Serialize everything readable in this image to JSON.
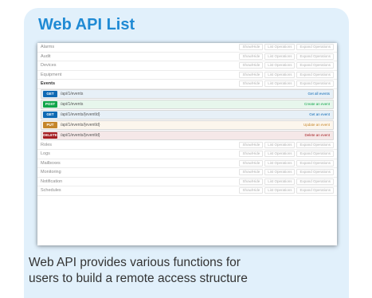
{
  "card": {
    "title": "Web API List",
    "caption_line1": "Web API provides various functions for",
    "caption_line2": "users to build a remote access structure",
    "background_color": "#e1f0fb",
    "title_color": "#1f8ad4"
  },
  "screenshot": {
    "groups_before": [
      {
        "name": "Alarms"
      },
      {
        "name": "Audit"
      },
      {
        "name": "Devices"
      },
      {
        "name": "Equipment"
      }
    ],
    "active_group": {
      "name": "Events"
    },
    "row_actions": [
      "Show/Hide",
      "List Operations",
      "Expand Operations"
    ],
    "endpoints": [
      {
        "method": "GET",
        "path": "/api/1/events",
        "desc": "Get all events",
        "badge_color": "#0f6ab4",
        "row_color": "#e7f0f7",
        "desc_color": "#0f6ab4"
      },
      {
        "method": "POST",
        "path": "/api/1/events",
        "desc": "Create an event",
        "badge_color": "#10a54a",
        "row_color": "#e7f6ec",
        "desc_color": "#10a54a"
      },
      {
        "method": "GET",
        "path": "/api/1/events/{eventId}",
        "desc": "Get an event",
        "badge_color": "#0f6ab4",
        "row_color": "#e7f0f7",
        "desc_color": "#0f6ab4"
      },
      {
        "method": "PUT",
        "path": "/api/1/events/{eventId}",
        "desc": "Update an event",
        "badge_color": "#c5862b",
        "row_color": "#fcf6ed",
        "desc_color": "#c5862b"
      },
      {
        "method": "DELETE",
        "path": "/api/1/events/{eventId}",
        "desc": "Delete an event",
        "badge_color": "#a41e22",
        "row_color": "#f5e8e8",
        "desc_color": "#a41e22"
      }
    ],
    "groups_after": [
      {
        "name": "Roles"
      },
      {
        "name": "Logs"
      },
      {
        "name": "Mailboxes"
      },
      {
        "name": "Monitoring"
      },
      {
        "name": "Notification"
      },
      {
        "name": "Schedules"
      }
    ]
  }
}
